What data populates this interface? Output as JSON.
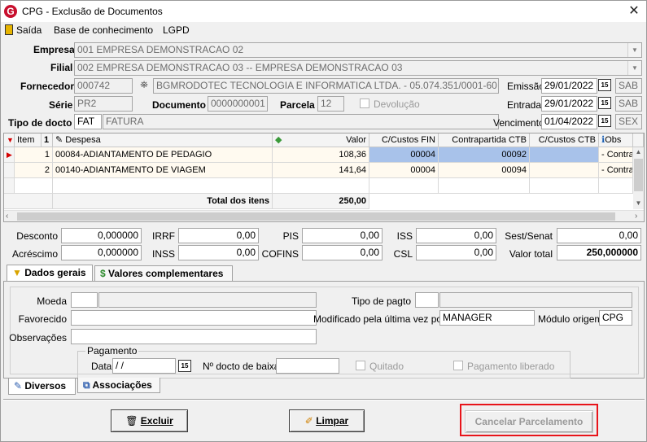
{
  "window": {
    "title": "CPG - Exclusão de Documentos",
    "close_glyph": "✕",
    "icon": "app-logo-icon"
  },
  "menu": {
    "items": [
      {
        "label": "Saída"
      },
      {
        "label": "Base de conhecimento"
      },
      {
        "label": "LGPD"
      }
    ]
  },
  "header": {
    "empresa_label": "Empresa",
    "empresa_value": "001 EMPRESA DEMONSTRACAO 02",
    "filial_label": "Filial",
    "filial_value": "002 EMPRESA DEMONSTRACAO 03 -- EMPRESA DEMONSTRACAO 03",
    "fornecedor_label": "Fornecedor",
    "fornecedor_code": "000742",
    "fornecedor_name": "BGMRODOTEC TECNOLOGIA E INFORMATICA LTDA. - 05.074.351/0001-60",
    "serie_label": "Série",
    "serie_value": "PR2",
    "documento_label": "Documento",
    "documento_value": "0000000001",
    "parcela_label": "Parcela",
    "parcela_value": "12",
    "devolucao_label": "Devolução",
    "tipo_label": "Tipo de docto",
    "tipo_code": "FAT",
    "tipo_desc": "FATURA",
    "emissao_label": "Emissão",
    "emissao_value": "29/01/2022",
    "emissao_dow": "SAB",
    "entrada_label": "Entrada",
    "entrada_value": "29/01/2022",
    "entrada_dow": "SAB",
    "vencimento_label": "Vencimento",
    "vencimento_value": "01/04/2022",
    "vencimento_dow": "SEX",
    "calendar_glyph": "15"
  },
  "grid": {
    "columns": {
      "item": "Item",
      "sort": "1",
      "despesa": "Despesa",
      "valor": "Valor",
      "ccfin": "C/Custos FIN",
      "contra": "Contrapartida CTB",
      "ccctb": "C/Custos CTB",
      "obs": "Obs"
    },
    "rows": [
      {
        "item": "1",
        "despesa": "00084-ADIANTAMENTO DE PEDAGIO",
        "valor": "108,36",
        "ccfin": "00004",
        "contra": "00092",
        "ccctb": "",
        "obs": "- Contra"
      },
      {
        "item": "2",
        "despesa": "00140-ADIANTAMENTO DE VIAGEM",
        "valor": "141,64",
        "ccfin": "00004",
        "contra": "00094",
        "ccctb": "",
        "obs": "- Contra"
      }
    ],
    "total_label": "Total dos itens",
    "total_value": "250,00"
  },
  "totals": {
    "desconto_label": "Desconto",
    "desconto": "0,000000",
    "acrescimo_label": "Acréscimo",
    "acrescimo": "0,000000",
    "irrf_label": "IRRF",
    "irrf": "0,00",
    "inss_label": "INSS",
    "inss": "0,00",
    "pis_label": "PIS",
    "pis": "0,00",
    "cofins_label": "COFINS",
    "cofins": "0,00",
    "iss_label": "ISS",
    "iss": "0,00",
    "csl_label": "CSL",
    "csl": "0,00",
    "sest_label": "Sest/Senat",
    "sest": "0,00",
    "total_label": "Valor total",
    "total": "250,000000"
  },
  "tabs": {
    "dados_gerais": "Dados gerais",
    "valores_compl": "Valores complementares"
  },
  "dados": {
    "moeda_label": "Moeda",
    "moeda_code": "",
    "moeda_desc": "",
    "favorecido_label": "Favorecido",
    "favorecido": "",
    "obs_label": "Observações",
    "obs": "",
    "tipo_pagto_label": "Tipo de pagto",
    "tipo_pagto_code": "",
    "tipo_pagto_desc": "",
    "modificado_label": "Modificado pela última vez por",
    "modificado": "MANAGER",
    "modulo_label": "Módulo origem",
    "modulo": "CPG",
    "pagamento_label": "Pagamento",
    "data_label": "Data",
    "data_value": " /  /",
    "baixa_label": "Nº docto de baixa",
    "baixa_value": "",
    "quitado_label": "Quitado",
    "liberado_label": "Pagamento liberado"
  },
  "bottom_tabs": {
    "diversos": "Diversos",
    "associacoes": "Associações"
  },
  "buttons": {
    "excluir": "Excluir",
    "limpar": "Limpar",
    "cancelar": "Cancelar Parcelamento"
  },
  "colors": {
    "highlight_red": "#e8141a",
    "selected_cell": "#a8c2ea",
    "row_bg": "#fffaf0"
  }
}
